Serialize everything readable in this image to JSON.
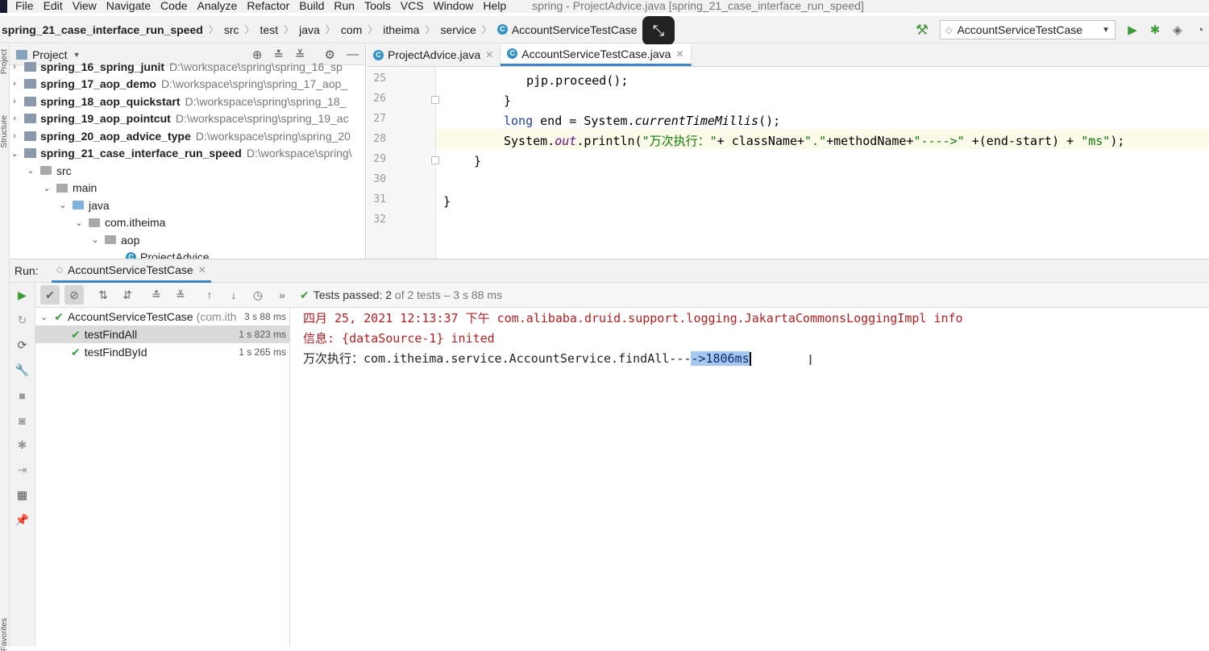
{
  "menu": {
    "items": [
      "File",
      "Edit",
      "View",
      "Navigate",
      "Code",
      "Analyze",
      "Refactor",
      "Build",
      "Run",
      "Tools",
      "VCS",
      "Window",
      "Help"
    ],
    "window_title": "spring - ProjectAdvice.java [spring_21_case_interface_run_speed]"
  },
  "breadcrumbs": [
    "spring_21_case_interface_run_speed",
    "src",
    "test",
    "java",
    "com",
    "itheima",
    "service",
    "AccountServiceTestCase"
  ],
  "run_config": {
    "label": "AccountServiceTestCase"
  },
  "project_panel": {
    "title": "Project",
    "rows": [
      {
        "name": "spring_16_spring_junit",
        "path": "D:\\workspace\\spring\\spring_16_sp"
      },
      {
        "name": "spring_17_aop_demo",
        "path": "D:\\workspace\\spring\\spring_17_aop_"
      },
      {
        "name": "spring_18_aop_quickstart",
        "path": "D:\\workspace\\spring\\spring_18_"
      },
      {
        "name": "spring_19_aop_pointcut",
        "path": "D:\\workspace\\spring\\spring_19_ac"
      },
      {
        "name": "spring_20_aop_advice_type",
        "path": "D:\\workspace\\spring\\spring_20"
      },
      {
        "name": "spring_21_case_interface_run_speed",
        "path": "D:\\workspace\\spring\\"
      }
    ],
    "tree": [
      "src",
      "main",
      "java",
      "com.itheima",
      "aop",
      "ProjectAdvice"
    ]
  },
  "editor": {
    "tabs": [
      "ProjectAdvice.java",
      "AccountServiceTestCase.java"
    ],
    "line_numbers": [
      "25",
      "26",
      "27",
      "28",
      "29",
      "30",
      "31",
      "32"
    ],
    "code": {
      "l25": "pjp.proceed();",
      "l26": "}",
      "l27_kw": "long",
      "l27_a": " end = System.",
      "l27_it": "currentTimeMillis",
      "l27_b": "();",
      "l28_a": "System.",
      "l28_it": "out",
      "l28_b": ".println(",
      "l28_s1": "\"万次执行：\"",
      "l28_c": "+ className+",
      "l28_s2": "\".\"",
      "l28_d": "+methodName+",
      "l28_s3": "\"---->\"",
      "l28_e": " +(end-start) + ",
      "l28_s4": "\"ms\"",
      "l28_f": ");",
      "l29": "}",
      "l31": "}"
    }
  },
  "run": {
    "label": "Run:",
    "tab": "AccountServiceTestCase",
    "status_prefix": "Tests passed:",
    "status_count": "2",
    "status_rest": "of 2 tests – 3 s 88 ms",
    "tests": [
      {
        "name": "AccountServiceTestCase",
        "suffix": "(com.ith",
        "time": "3 s 88 ms"
      },
      {
        "name": "testFindAll",
        "time": "1 s 823 ms"
      },
      {
        "name": "testFindById",
        "time": "1 s 265 ms"
      }
    ],
    "console": {
      "line1": "四月 25, 2021 12:13:37 下午 com.alibaba.druid.support.logging.JakartaCommonsLoggingImpl info",
      "line2": "信息: {dataSource-1} inited",
      "line3_a": "万次执行：com.itheima.service.AccountService.findAll---",
      "line3_sel": "->1806ms"
    }
  }
}
